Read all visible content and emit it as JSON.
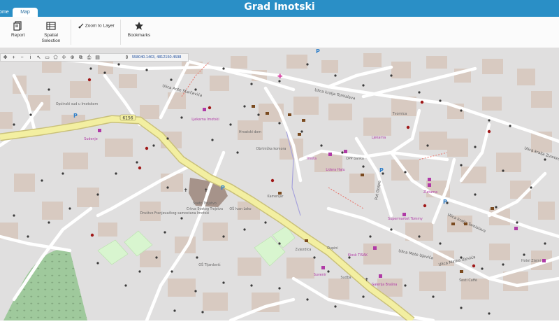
{
  "app": {
    "title": "Grad Imotski",
    "tabs": [
      {
        "label": "Home",
        "active": false
      },
      {
        "label": "Map",
        "active": true
      }
    ]
  },
  "ribbon": {
    "buttons": [
      {
        "label": "Report",
        "icon": "report-icon"
      },
      {
        "label": "Spatial\nSelection",
        "icon": "spatial-selection-icon"
      },
      {
        "label": "Zoom to Layer",
        "icon": "zoom-to-layer-icon"
      },
      {
        "label": "Bookmarks",
        "icon": "star-icon"
      }
    ]
  },
  "toolbar": {
    "tools": [
      "pan-icon",
      "zoom-in-icon",
      "zoom-out-icon",
      "identify-icon",
      "select-icon",
      "rectangle-icon",
      "polygon-icon",
      "measure-icon",
      "zoom-extent-icon",
      "layers-icon",
      "print-icon",
      "export-icon"
    ],
    "coordinates": "558040.1463, 4812150.4598"
  },
  "map": {
    "colors": {
      "background": "#e0dfdf",
      "building": "#d8cac1",
      "main_road": "#f3efa1",
      "main_road_casing": "#c9c07a",
      "minor_road": "#ffffff",
      "park": "#d8f5cf",
      "cemetery": "#9fc99c",
      "church": "#a6938a",
      "label": "#5f5f5f",
      "poi": "#b03aa6"
    },
    "street_labels": [
      "Ulica kralja Tomislava",
      "Ulica Ante Starčevića",
      "Ulica kralja Tomislava",
      "Put Gospe",
      "Ulica Mate Ujevića",
      "Ulica Matka Ujevića",
      "Ulica kralja Zvonimira"
    ],
    "road_ref": "6156",
    "places": [
      "Općinski sud u Imotskom",
      "Sudenje",
      "Ljekarna Imotski",
      "Crkva Svetog Trojstva",
      "Hrvatski dom",
      "Obrtnička komora",
      "Imota",
      "OPP banka",
      "Lidera Halu",
      "Zvjezdica",
      "Tvornica",
      "Društvo Franjevačkog samostana Imotski",
      "Sveto Trojstvo",
      "OŠ Tijardović",
      "Kiosk TISAK",
      "Supermarket Tommy",
      "Zlatarna",
      "Dupini",
      "Suvenir",
      "Galerija Brašna",
      "Šesti Caffè",
      "Hotel Zlatni",
      "Sudba",
      "Ljekarna",
      "Kamenjar",
      "OŠ Ivan Leko"
    ]
  }
}
